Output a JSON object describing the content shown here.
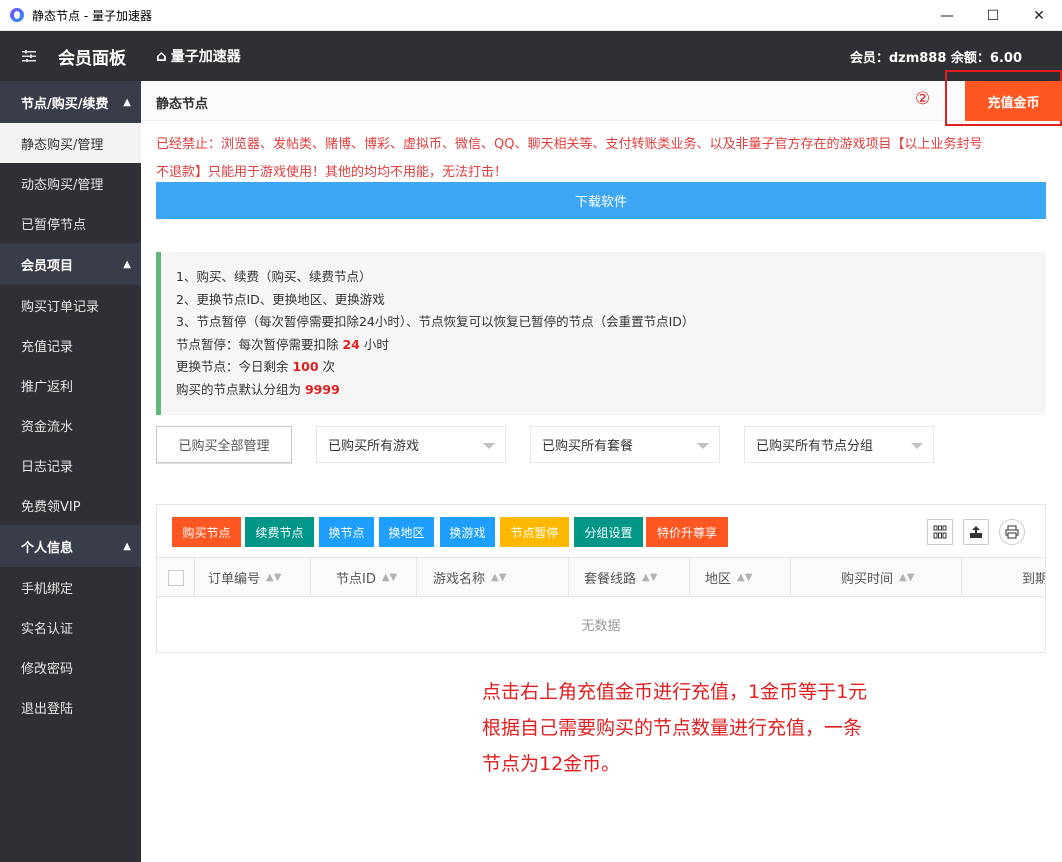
{
  "window": {
    "title": "静态节点 - 量子加速器",
    "minimize": "—",
    "maximize": "☐",
    "close": "✕"
  },
  "header": {
    "brand": "会员面板",
    "home_label": "量子加速器",
    "member_info": "会员：dzm888 余额：6.00"
  },
  "sidebar": {
    "groups": [
      {
        "label": "节点/购买/续费",
        "items": [
          "静态购买/管理",
          "动态购买/管理",
          "已暂停节点"
        ]
      },
      {
        "label": "会员项目",
        "items": [
          "购买订单记录",
          "充值记录",
          "推广返利",
          "资金流水",
          "日志记录",
          "免费领VIP"
        ]
      },
      {
        "label": "个人信息",
        "items": [
          "手机绑定",
          "实名认证",
          "修改密码",
          "退出登陆"
        ]
      }
    ]
  },
  "page": {
    "title": "静态节点",
    "marker": "②",
    "recharge_label": "充值金币",
    "banned_line1": "已经禁止：浏览器、发帖类、赌博、博彩、虚拟币、微信、QQ、聊天相关等、支付转账类业务、以及非量子官方存在的游戏项目【以上业务封号",
    "banned_line2": "不退款】只能用于游戏使用！其他的均均不用能，无法打击！",
    "download_label": "下载软件",
    "notice": {
      "line1": "1、购买、续费（购买、续费节点）",
      "line2": "2、更换节点ID、更换地区、更换游戏",
      "line3": "3、节点暂停（每次暂停需要扣除24小时）、节点恢复可以恢复已暂停的节点（会重置节点ID）",
      "line4_prefix": "节点暂停：每次暂停需要扣除 ",
      "line4_value": "24",
      "line4_suffix": " 小时",
      "line5_prefix": "更换节点：今日剩余 ",
      "line5_value": "100",
      "line5_suffix": " 次",
      "line6_prefix": "购买的节点默认分组为 ",
      "line6_value": "9999"
    },
    "filters": {
      "manage_all": "已购买全部管理",
      "game_select": "已购买所有游戏",
      "package_select": "已购买所有套餐",
      "group_select": "已购买所有节点分组"
    },
    "toolbar": {
      "buttons": [
        {
          "label": "购买节点",
          "color": "#ff5722"
        },
        {
          "label": "续费节点",
          "color": "#009688"
        },
        {
          "label": "换节点",
          "color": "#1e9fff"
        },
        {
          "label": "换地区",
          "color": "#1e9fff"
        },
        {
          "label": "换游戏",
          "color": "#1e9fff"
        },
        {
          "label": "节点暂停",
          "color": "#ffb800"
        },
        {
          "label": "分组设置",
          "color": "#009688"
        },
        {
          "label": "特价升尊享",
          "color": "#ff5722"
        }
      ]
    },
    "table": {
      "columns": [
        "订单编号",
        "节点ID",
        "游戏名称",
        "套餐线路",
        "地区",
        "购买时间",
        "到期"
      ],
      "empty_text": "无数据"
    },
    "annotation": {
      "line1": "点击右上角充值金币进行充值，1金币等于1元",
      "line2": "根据自己需要购买的节点数量进行充值，一条",
      "line3": "节点为12金币。"
    }
  }
}
